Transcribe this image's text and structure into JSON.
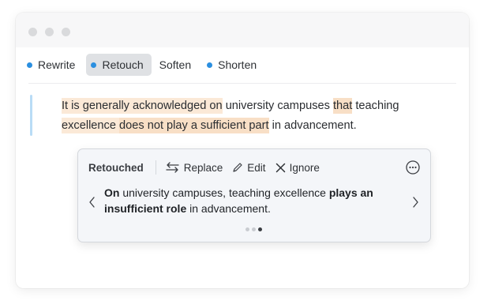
{
  "tabs": [
    {
      "label": "Rewrite",
      "bullet": true,
      "active": false
    },
    {
      "label": "Retouch",
      "bullet": true,
      "active": true
    },
    {
      "label": "Soften",
      "bullet": false,
      "active": false
    },
    {
      "label": "Shorten",
      "bullet": true,
      "active": false
    }
  ],
  "passage": {
    "s1": "It is generally acknowledged on",
    "s2": " university campuses ",
    "s3": "that",
    "s4": " teaching",
    "s5": "excellence ",
    "s6": "does not play a sufficient part",
    "s7": " in advancement."
  },
  "popup": {
    "title": "Retouched",
    "replace_label": "Replace",
    "edit_label": "Edit",
    "ignore_label": "Ignore",
    "suggestion": {
      "p1": "On",
      "p2": " university campuses, teaching excellence ",
      "p3": "plays an insufficient role",
      "p4": " in advancement."
    },
    "pager": {
      "count": 3,
      "current": 3
    }
  },
  "colors": {
    "accent": "#2b8fe0",
    "highlight": "#fbe9d7",
    "highlight_strong": "#f8dfc6",
    "quote_bar": "#b9dcf6"
  }
}
